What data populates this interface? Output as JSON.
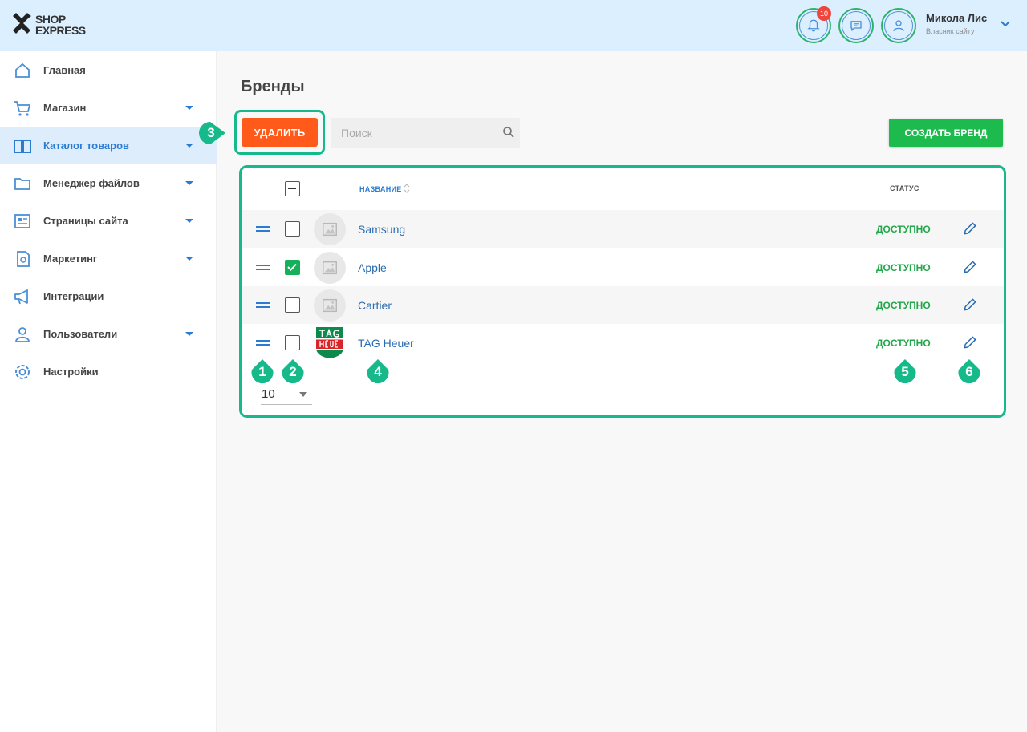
{
  "header": {
    "logo_line1": "SHOP",
    "logo_line2": "EXPRESS",
    "notifications_count": "10",
    "user_name": "Микола Лис",
    "user_role": "Власник сайту"
  },
  "sidebar": {
    "items": [
      {
        "label": "Главная",
        "icon": "home-icon",
        "has_submenu": false,
        "active": false
      },
      {
        "label": "Магазин",
        "icon": "cart-icon",
        "has_submenu": true,
        "active": false
      },
      {
        "label": "Каталог товаров",
        "icon": "book-icon",
        "has_submenu": true,
        "active": true
      },
      {
        "label": "Менеджер файлов",
        "icon": "folder-icon",
        "has_submenu": true,
        "active": false
      },
      {
        "label": "Страницы сайта",
        "icon": "pages-icon",
        "has_submenu": true,
        "active": false
      },
      {
        "label": "Маркетинг",
        "icon": "marketing-icon",
        "has_submenu": true,
        "active": false
      },
      {
        "label": "Интеграции",
        "icon": "megaphone-icon",
        "has_submenu": false,
        "active": false
      },
      {
        "label": "Пользователи",
        "icon": "users-icon",
        "has_submenu": true,
        "active": false
      },
      {
        "label": "Настройки",
        "icon": "gear-icon",
        "has_submenu": false,
        "active": false
      }
    ]
  },
  "main": {
    "title": "Бренды",
    "delete_label": "УДАЛИТЬ",
    "search_placeholder": "Поиск",
    "create_label": "СОЗДАТЬ БРЕНД",
    "columns": {
      "name": "НАЗВАНИЕ",
      "status": "СТАТУС"
    },
    "rows": [
      {
        "name": "Samsung",
        "status": "ДОСТУПНО",
        "checked": false,
        "logo": "placeholder"
      },
      {
        "name": "Apple",
        "status": "ДОСТУПНО",
        "checked": true,
        "logo": "placeholder"
      },
      {
        "name": "Cartier",
        "status": "ДОСТУПНО",
        "checked": false,
        "logo": "placeholder"
      },
      {
        "name": "TAG Heuer",
        "status": "ДОСТУПНО",
        "checked": false,
        "logo": "tag-heuer"
      }
    ],
    "per_page": "10"
  },
  "markers": [
    "1",
    "2",
    "3",
    "4",
    "5",
    "6"
  ],
  "colors": {
    "accent_blue": "#2a7bd2",
    "delete_orange": "#ff5a1a",
    "create_green": "#1dbb4e",
    "status_green": "#22a84a",
    "annotation_teal": "#16b98a"
  }
}
